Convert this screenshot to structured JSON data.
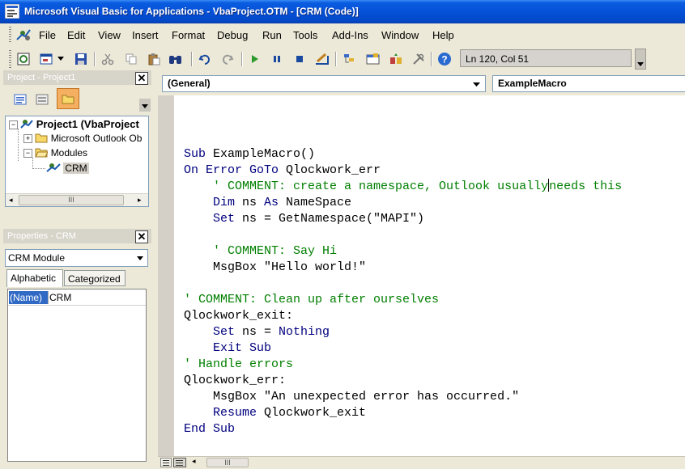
{
  "window": {
    "title": "Microsoft Visual Basic for Applications - VbaProject.OTM - [CRM (Code)]"
  },
  "menu": {
    "items": [
      "File",
      "Edit",
      "View",
      "Insert",
      "Format",
      "Debug",
      "Run",
      "Tools",
      "Add-Ins",
      "Window",
      "Help"
    ]
  },
  "toolbar": {
    "position_text": "Ln 120, Col 51",
    "icons": [
      "view-host-icon",
      "insert-userform-icon",
      "save-icon",
      "cut-icon",
      "copy-icon",
      "paste-icon",
      "find-icon",
      "undo-icon",
      "redo-icon",
      "run-icon",
      "break-icon",
      "reset-icon",
      "design-mode-icon",
      "project-explorer-icon",
      "properties-window-icon",
      "object-browser-icon",
      "toolbox-icon",
      "help-icon"
    ]
  },
  "project_pane": {
    "title": "Project - Project1",
    "tree": {
      "root": "Project1 (VbaProject",
      "folder1": "Microsoft Outlook Ob",
      "folder2": "Modules",
      "module": "CRM"
    },
    "scroll_thumb": "III"
  },
  "properties_pane": {
    "title": "Properties - CRM",
    "object": "CRM Module",
    "tabs": [
      "Alphabetic",
      "Categorized"
    ],
    "property_name": "(Name)",
    "property_value": "CRM"
  },
  "code_window": {
    "object_combo": "(General)",
    "procedure_combo": "ExampleMacro",
    "lines": [
      {
        "tokens": [
          [
            "kw",
            "Sub"
          ],
          [
            "t",
            " ExampleMacro()"
          ]
        ]
      },
      {
        "tokens": [
          [
            "kw",
            "On Error GoTo"
          ],
          [
            "t",
            " Qlockwork_err"
          ]
        ]
      },
      {
        "tokens": [
          [
            "cm",
            "    ' COMMENT: create a namespace, Outlook usually"
          ],
          [
            "caret",
            ""
          ],
          [
            "cm",
            "needs this"
          ]
        ]
      },
      {
        "tokens": [
          [
            "kw",
            "    Dim"
          ],
          [
            "t",
            " ns "
          ],
          [
            "kw",
            "As"
          ],
          [
            "t",
            " NameSpace"
          ]
        ]
      },
      {
        "tokens": [
          [
            "kw",
            "    Set"
          ],
          [
            "t",
            " ns = GetNamespace(\"MAPI\")"
          ]
        ]
      },
      {
        "tokens": []
      },
      {
        "tokens": [
          [
            "cm",
            "    ' COMMENT: Say Hi"
          ]
        ]
      },
      {
        "tokens": [
          [
            "t",
            "    MsgBox \"Hello world!\""
          ]
        ]
      },
      {
        "tokens": []
      },
      {
        "tokens": [
          [
            "cm",
            "' COMMENT: Clean up after ourselves"
          ]
        ]
      },
      {
        "tokens": [
          [
            "t",
            "Qlockwork_exit:"
          ]
        ]
      },
      {
        "tokens": [
          [
            "kw",
            "    Set"
          ],
          [
            "t",
            " ns = "
          ],
          [
            "kw",
            "Nothing"
          ]
        ]
      },
      {
        "tokens": [
          [
            "kw",
            "    Exit Sub"
          ]
        ]
      },
      {
        "tokens": [
          [
            "cm",
            "' Handle errors"
          ]
        ]
      },
      {
        "tokens": [
          [
            "t",
            "Qlockwork_err:"
          ]
        ]
      },
      {
        "tokens": [
          [
            "t",
            "    MsgBox \"An unexpected error has occurred.\""
          ]
        ]
      },
      {
        "tokens": [
          [
            "kw",
            "    Resume"
          ],
          [
            "t",
            " Qlockwork_exit"
          ]
        ]
      },
      {
        "tokens": [
          [
            "kw",
            "End Sub"
          ]
        ]
      }
    ],
    "scroll_thumb": "III"
  },
  "colors": {
    "keyword": "#00007f",
    "comment": "#007f00",
    "titlebar": "#0551d8"
  }
}
